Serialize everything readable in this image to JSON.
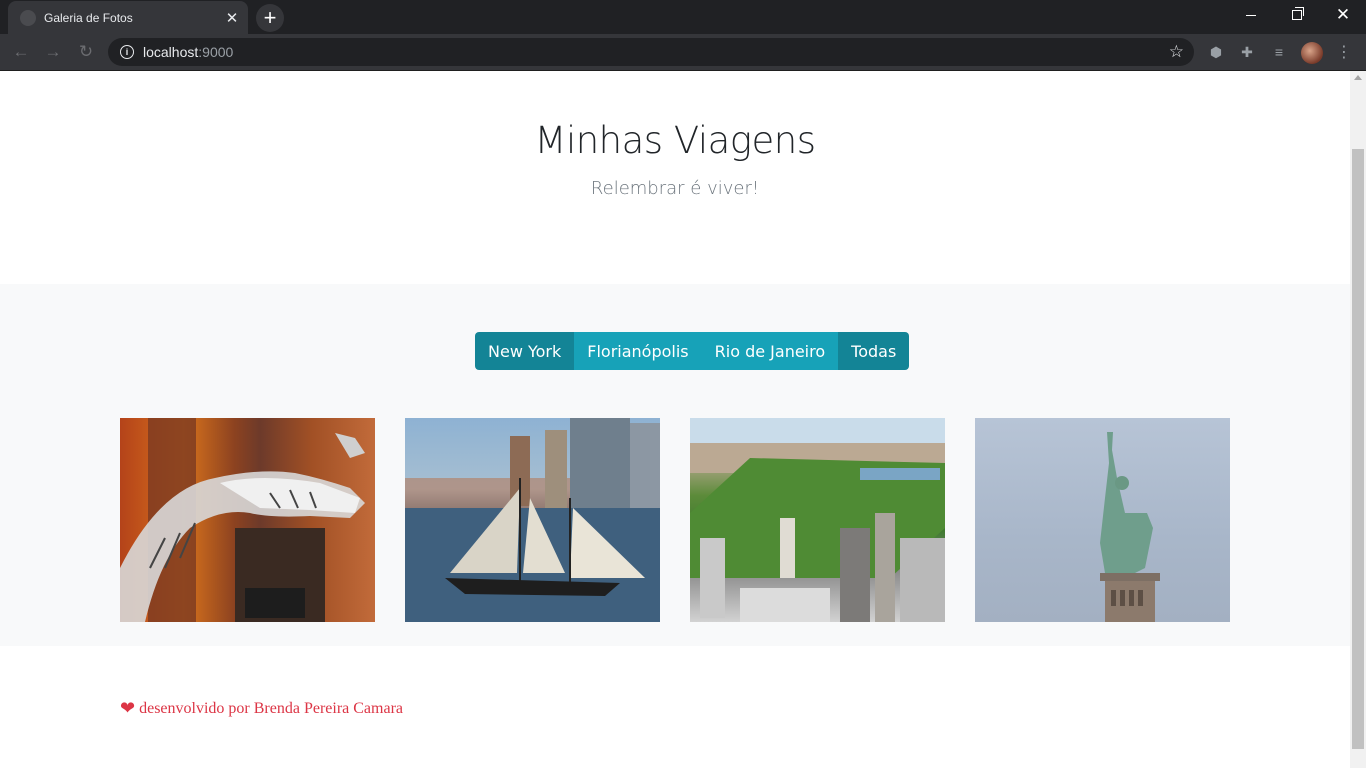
{
  "browser": {
    "tab_title": "Galeria de Fotos",
    "url_host": "localhost",
    "url_port": ":9000"
  },
  "hero": {
    "title": "Minhas Viagens",
    "subtitle": "Relembrar é viver!"
  },
  "filters": {
    "buttons": [
      {
        "label": "New York"
      },
      {
        "label": "Florianópolis"
      },
      {
        "label": "Rio de Janeiro"
      },
      {
        "label": "Todas"
      }
    ]
  },
  "photos": [
    {
      "icon": "dinosaur-skeleton-photo"
    },
    {
      "icon": "sailboat-photo"
    },
    {
      "icon": "central-park-photo"
    },
    {
      "icon": "statue-of-liberty-photo"
    }
  ],
  "footer": {
    "text": "desenvolvido por Brenda Pereira Camara"
  },
  "colors": {
    "btn_active": "#138496",
    "btn_default": "#17a2b8",
    "footer_text": "#dc3545",
    "gallery_bg": "#f8f9fa"
  }
}
